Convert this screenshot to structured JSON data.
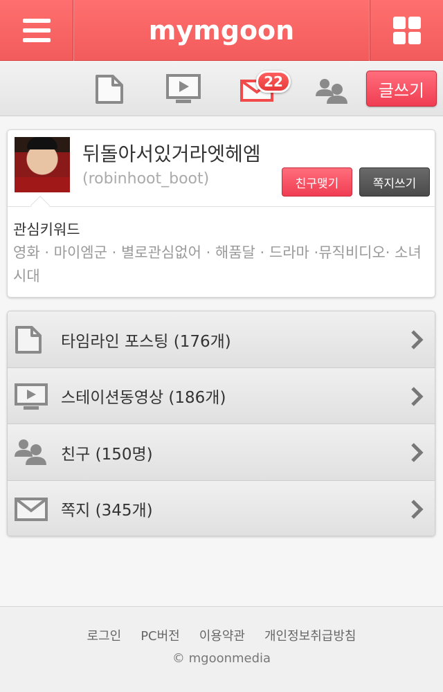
{
  "header": {
    "logo": "mymgoon",
    "menu_icon": "hamburger-icon",
    "apps_icon": "grid-icon"
  },
  "toolbar": {
    "icons": [
      "document-icon",
      "video-station-icon",
      "mail-icon",
      "friends-icon"
    ],
    "mail_badge": "22",
    "write_label": "글쓰기"
  },
  "profile": {
    "name": "뒤돌아서있거라엣헤엠",
    "user_id": "(robinhoot_boot)",
    "friend_button": "친구맺기",
    "message_button": "쪽지쓰기",
    "keywords_title": "관심키워드",
    "keywords": "영화 · 마이엠군 · 별로관심없어 · 해품달 · 드라마 ·뮤직비디오· 소녀시대"
  },
  "menu": {
    "items": [
      {
        "icon": "document-icon",
        "label": "타임라인 포스팅 (176개)"
      },
      {
        "icon": "video-station-icon",
        "label": "스테이션동영상 (186개)"
      },
      {
        "icon": "friends-icon",
        "label": "친구 (150명)"
      },
      {
        "icon": "mail-icon",
        "label": "쪽지 (345개)"
      }
    ]
  },
  "footer": {
    "links": [
      "로그인",
      "PC버전",
      "이용약관",
      "개인정보취급방침"
    ],
    "copyright": "© mgoonmedia"
  },
  "colors": {
    "brand": "#f25b5b",
    "button_red": "#f03d52",
    "button_dark": "#4a4a4a"
  }
}
